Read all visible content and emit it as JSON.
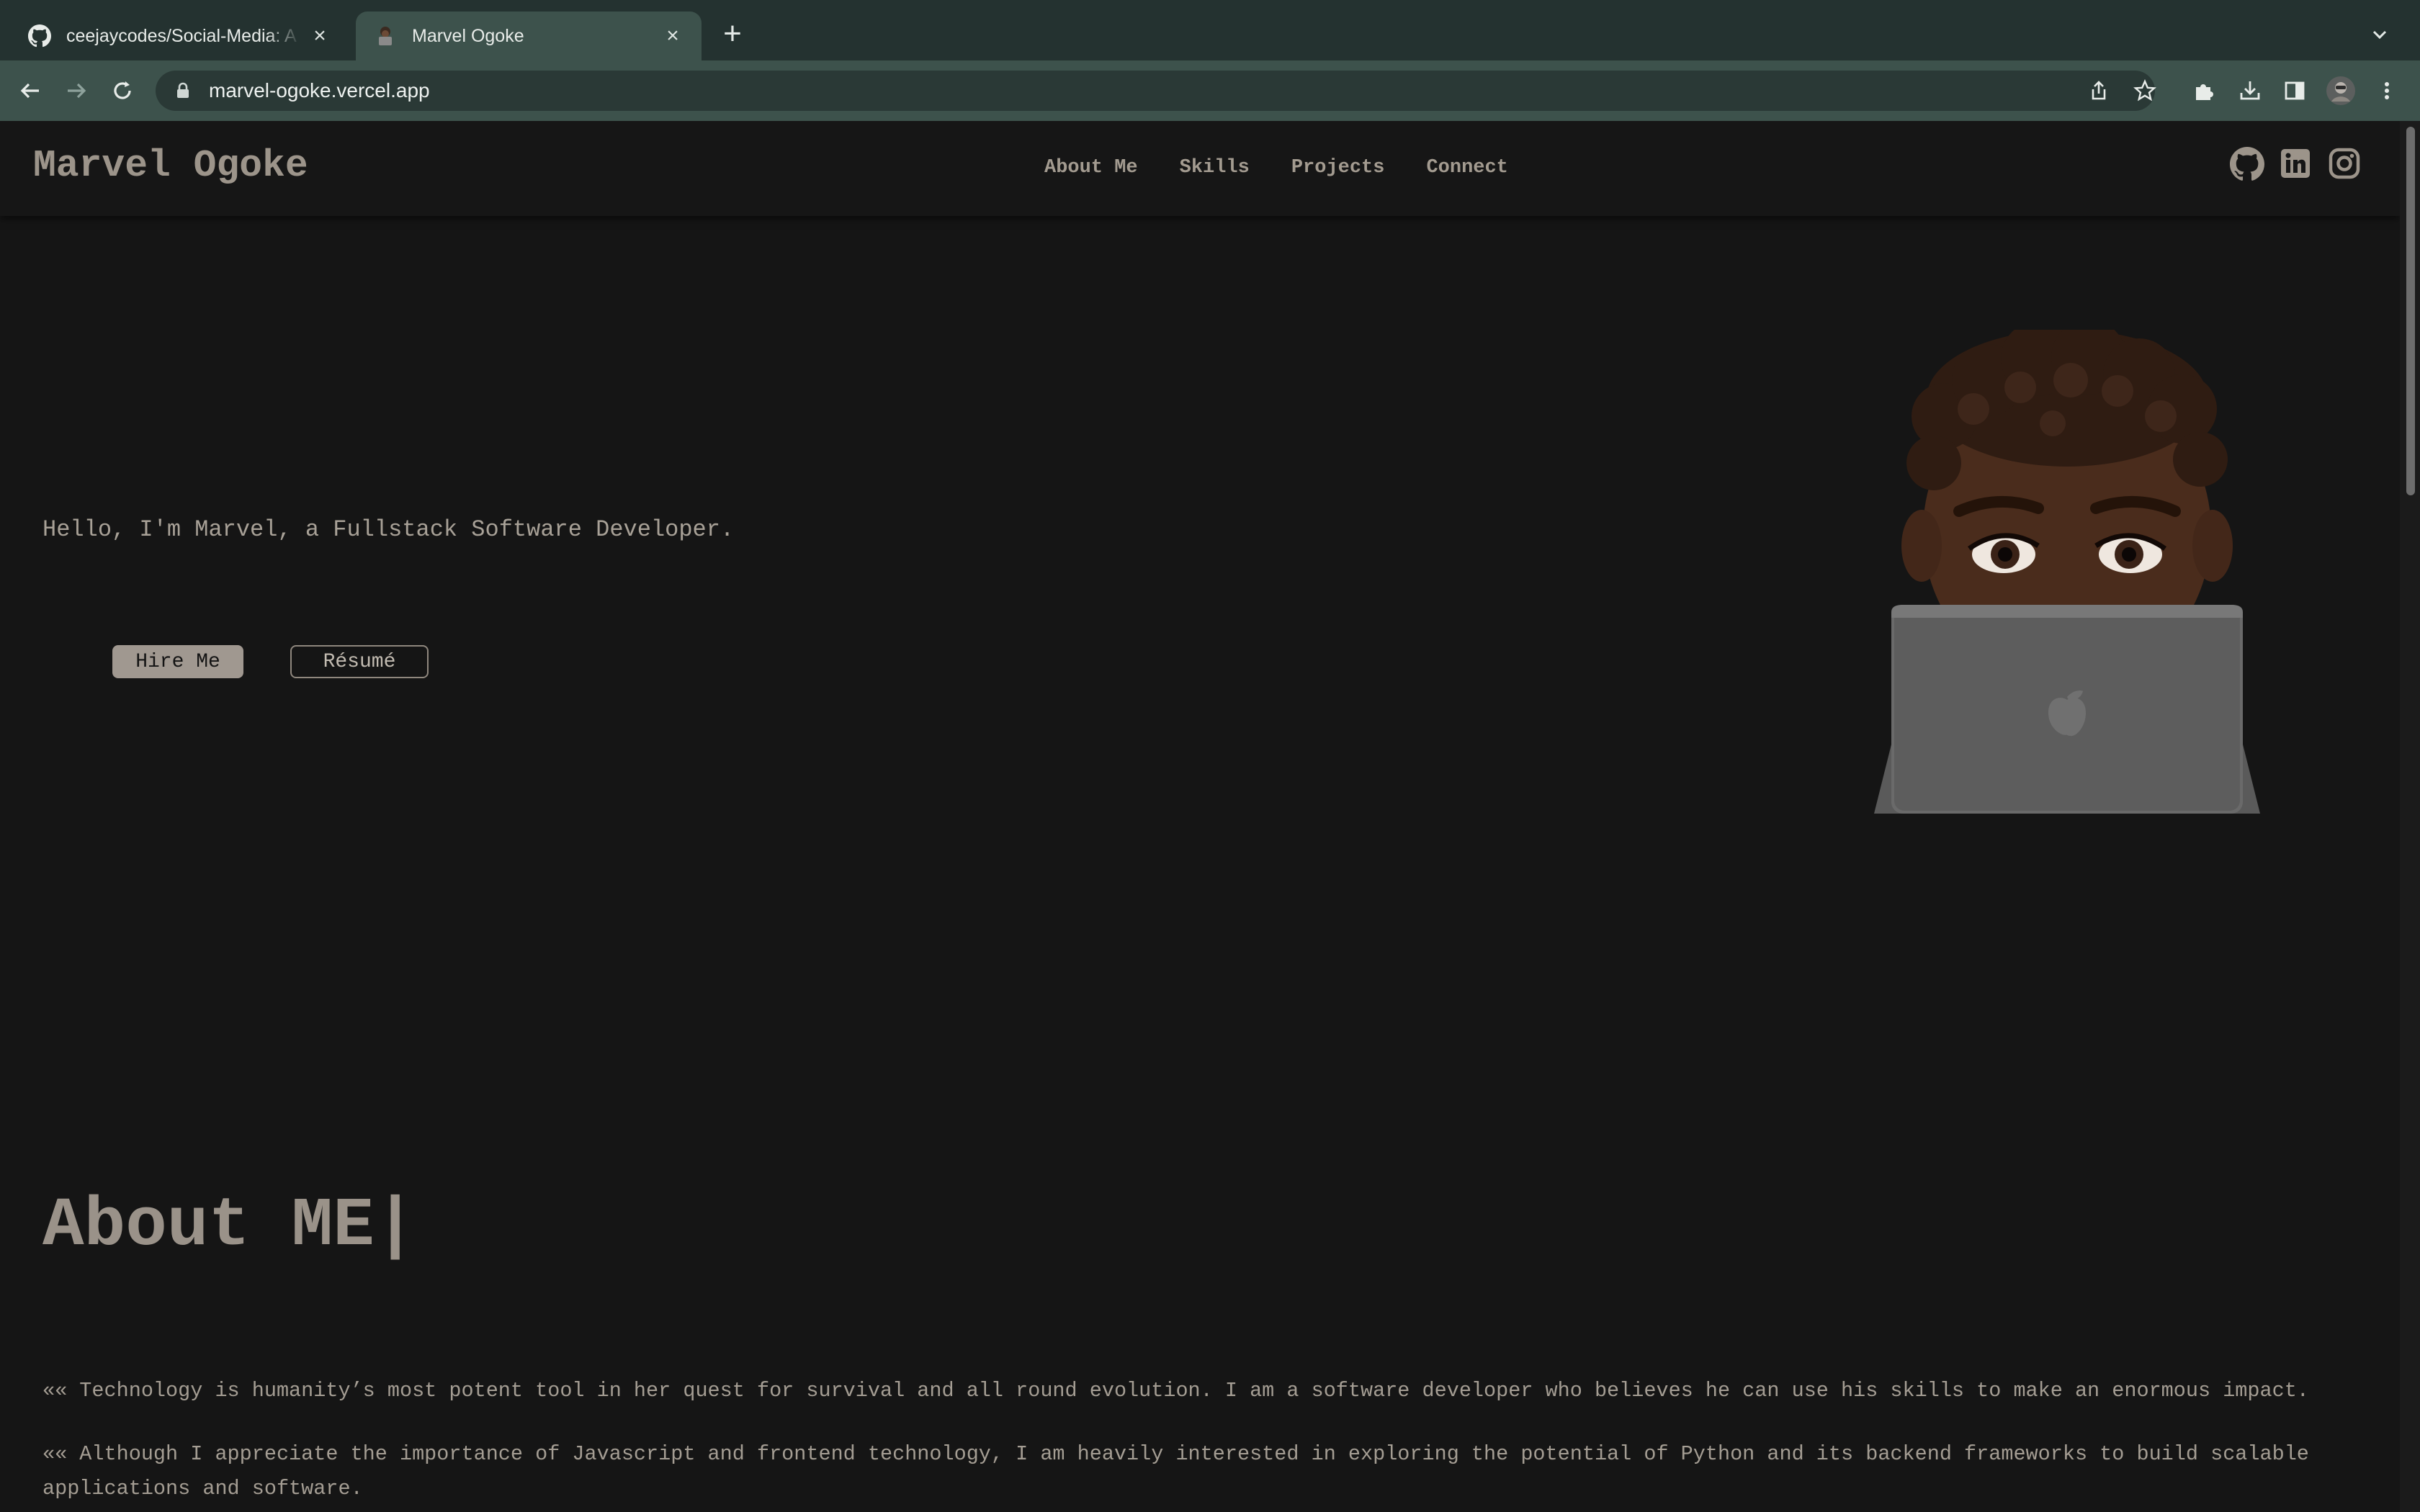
{
  "browser": {
    "tabs": [
      {
        "title": "ceejaycodes/Social-Media: A S",
        "favicon": "github-icon",
        "active": false
      },
      {
        "title": "Marvel Ogoke",
        "favicon": "memoji-icon",
        "active": true
      }
    ],
    "address": {
      "url": "marvel-ogoke.vercel.app"
    },
    "toolbar_icons": [
      "back-icon",
      "forward-icon",
      "reload-icon",
      "share-icon",
      "star-icon",
      "extensions-icon",
      "download-icon",
      "sidepanel-icon",
      "profile-icon",
      "menu-icon"
    ]
  },
  "site": {
    "brand": "Marvel Ogoke",
    "nav": [
      "About Me",
      "Skills",
      "Projects",
      "Connect"
    ],
    "social_icons": [
      "github-icon",
      "linkedin-icon",
      "instagram-icon"
    ],
    "hero": {
      "tagline": "Hello, I'm Marvel, a Fullstack Software Developer.",
      "hire_label": "Hire Me",
      "resume_label": "Résumé"
    },
    "about": {
      "heading": "About ME|",
      "paragraphs": [
        "«« Technology is humanity’s most potent tool in her quest for survival and all round evolution. I am a software developer who believes he can use his skills to make an enormous impact.",
        "«« Although I appreciate the importance of Javascript and frontend technology, I am heavily interested in exploring the potential of Python and its backend frameworks to build scalable applications and software."
      ]
    }
  },
  "colors": {
    "page_bg": "#151515",
    "accent": "#9c948a",
    "chrome_toolbar": "#3d524c",
    "chrome_tabstrip": "#243230"
  }
}
